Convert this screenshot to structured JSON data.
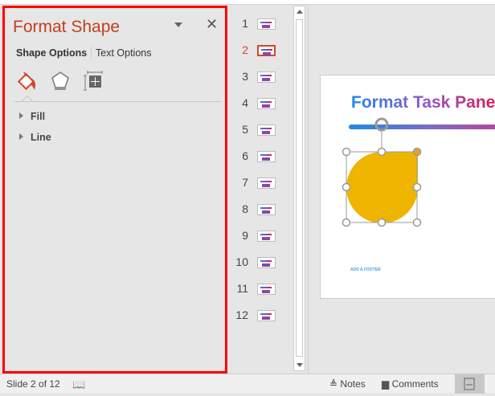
{
  "pane": {
    "title": "Format Shape",
    "tabs": [
      {
        "label": "Shape Options",
        "active": true
      },
      {
        "label": "Text Options",
        "active": false
      }
    ],
    "icons": [
      "fill-line-icon",
      "effects-pentagon-icon",
      "size-properties-icon"
    ],
    "sections": [
      {
        "label": "Fill"
      },
      {
        "label": "Line"
      }
    ]
  },
  "thumbnails": {
    "selected": 2,
    "numbers": [
      "1",
      "2",
      "3",
      "4",
      "5",
      "6",
      "7",
      "8",
      "9",
      "10",
      "11",
      "12"
    ]
  },
  "slide": {
    "title": "Format Task Pane",
    "footer": "ADD A FOOTER",
    "shape_color": "#EEB500"
  },
  "status": {
    "slide_info": "Slide 2 of 12",
    "notes": "Notes",
    "comments": "Comments"
  },
  "colors": {
    "accent": "#D24726",
    "highlight_border": "#FF0000"
  }
}
